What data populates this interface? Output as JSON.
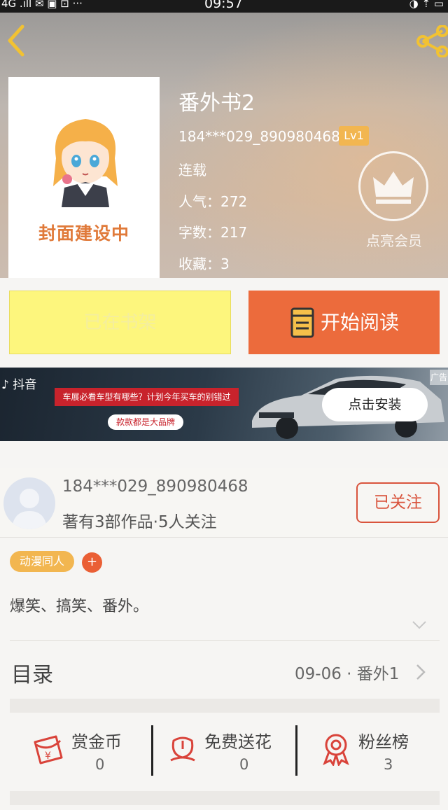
{
  "status_bar": {
    "left": "4G .ıll  ✉  ▣  ⊡  ···",
    "time": "09:57",
    "right": "◑  ⇡  ▭"
  },
  "book": {
    "title": "番外书2",
    "author": "184***029_890980468",
    "level": "Lv1",
    "status": "连载",
    "popularity": "人气：272",
    "word_count": "字数：217",
    "favorites": "收藏：3",
    "cover_text": "封面建设中"
  },
  "vip": {
    "label": "点亮会员"
  },
  "actions": {
    "shelf_label": "已在书架",
    "read_label": "开始阅读"
  },
  "ad": {
    "brand": "抖音",
    "note": "车展必看车型有哪些？计划今年买车的别错过",
    "sub_note": "款款都是大品牌",
    "install": "点击安装",
    "tag": "广告"
  },
  "author_card": {
    "name": "184***029_890980468",
    "stats": "著有3部作品·5人关注",
    "follow": "已关注"
  },
  "tags": {
    "tag1": "动漫同人",
    "add": "+"
  },
  "description": "爆笑、搞笑、番外。",
  "toc": {
    "label": "目录",
    "latest": "09-06 · 番外1"
  },
  "stats": [
    {
      "label": "赏金币",
      "value": "0"
    },
    {
      "label": "免费送花",
      "value": "0"
    },
    {
      "label": "粉丝榜",
      "value": "3"
    }
  ],
  "colors": {
    "accent": "#ec6b3c",
    "gold": "#f2b650",
    "shelf": "#fdf67d",
    "red": "#d9543d"
  }
}
